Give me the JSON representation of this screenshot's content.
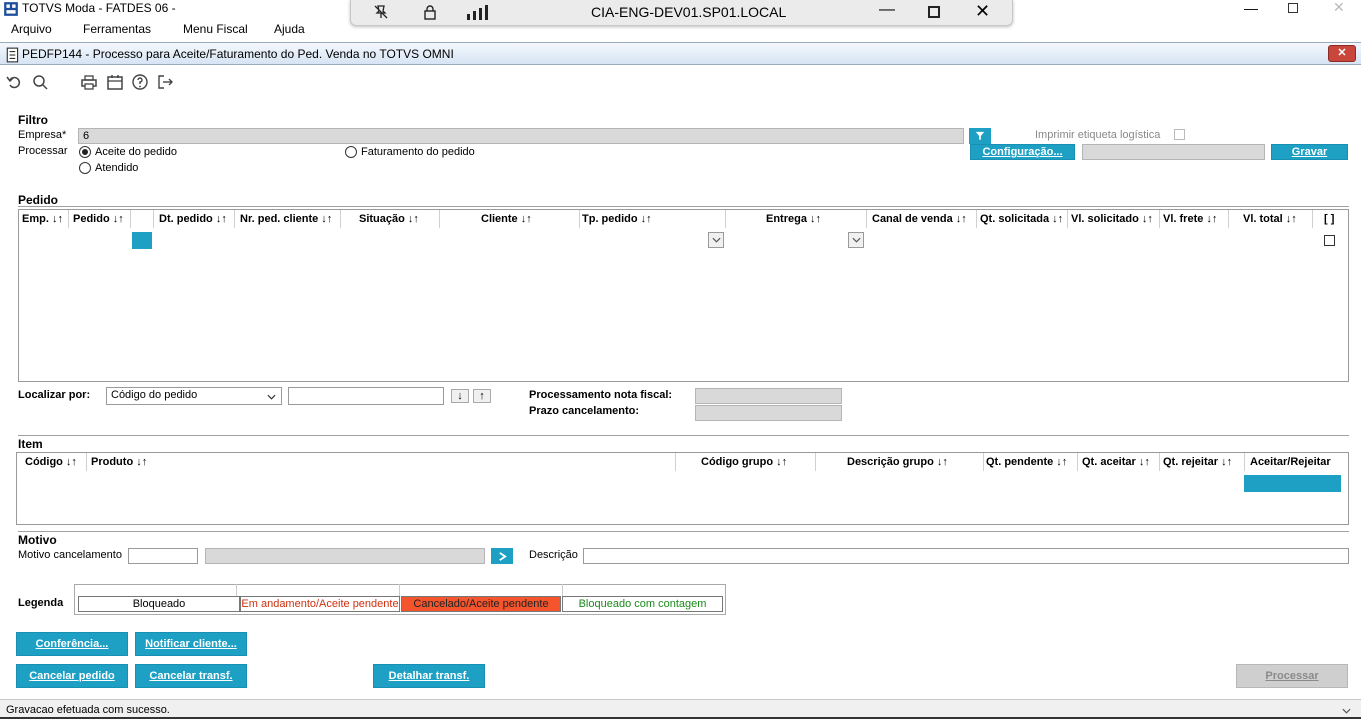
{
  "app_title": "TOTVS Moda - FATDES 06 -",
  "menu": [
    "Arquivo",
    "Ferramentas",
    "Menu Fiscal",
    "Ajuda"
  ],
  "remote": {
    "host": "CIA-ENG-DEV01.SP01.LOCAL"
  },
  "window_title": "PEDFP144 - Processo para Aceite/Faturamento do Ped. Venda no TOTVS OMNI",
  "filtro": {
    "title": "Filtro",
    "empresa_label": "Empresa*",
    "empresa_value": "6",
    "processar_label": "Processar",
    "options": [
      "Aceite do pedido",
      "Faturamento do pedido",
      "Atendido"
    ],
    "imprimir_label": "Imprimir etiqueta logística",
    "config_button": "Configuração...",
    "gravar_button": "Gravar"
  },
  "pedido": {
    "title": "Pedido",
    "columns": [
      "Emp. ↓↑",
      "Pedido ↓↑",
      "Dt. pedido ↓↑",
      "Nr. ped. cliente ↓↑",
      "Situação ↓↑",
      "Cliente ↓↑",
      "Tp. pedido ↓↑",
      "Entrega ↓↑",
      "Canal de venda ↓↑",
      "Qt. solicitada ↓↑",
      "Vl. solicitado ↓↑",
      "Vl. frete ↓↑",
      "Vl. total ↓↑",
      "[ ]"
    ]
  },
  "localizar": {
    "label": "Localizar por:",
    "select_value": "Código do pedido",
    "down_arrow": "↓",
    "up_arrow": "↑"
  },
  "processamento": {
    "nota_label": "Processamento nota fiscal:",
    "prazo_label": "Prazo cancelamento:"
  },
  "item": {
    "title": "Item",
    "columns": [
      "Código ↓↑",
      "Produto ↓↑",
      "Código grupo ↓↑",
      "Descrição grupo ↓↑",
      "Qt. pendente ↓↑",
      "Qt. aceitar ↓↑",
      "Qt. rejeitar ↓↑",
      "Aceitar/Rejeitar"
    ]
  },
  "motivo": {
    "title": "Motivo",
    "cancel_label": "Motivo cancelamento",
    "descricao_label": "Descrição"
  },
  "legenda": {
    "label": "Legenda",
    "items": [
      "Bloqueado",
      "Em andamento/Aceite pendente",
      "Cancelado/Aceite pendente",
      "Bloqueado com contagem"
    ],
    "colors": {
      "andamento_text": "#d03010",
      "cancelado_bg": "#f4552d",
      "contagem_text": "#1a8a1a"
    }
  },
  "buttons": {
    "conferencia": "Conferência...",
    "notificar": "Notificar cliente...",
    "cancelar_pedido": "Cancelar pedido",
    "cancelar_transf": "Cancelar transf.",
    "detalhar_transf": "Detalhar transf.",
    "processar": "Processar"
  },
  "status": "Gravacao efetuada com sucesso.",
  "icons": [
    "app-logo-icon",
    "undo-icon",
    "search-icon",
    "print-icon",
    "calendar-icon",
    "help-icon",
    "exit-icon",
    "filter-icon",
    "arrow-right-icon",
    "close-icon"
  ],
  "accent": "#1ea0c5"
}
